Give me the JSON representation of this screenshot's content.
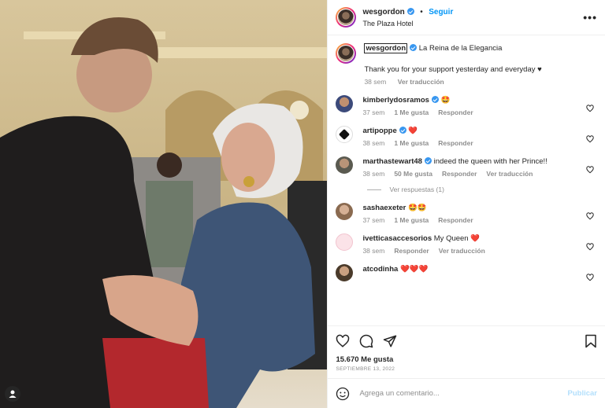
{
  "post": {
    "username": "wesgordon",
    "follow_label": "Seguir",
    "dot": "•",
    "location": "The Plaza Hotel",
    "more": "•••",
    "caption_user": "wesgordon",
    "caption_text": "La Reina de la Elegancia",
    "caption_body": "Thank you for your support yesterday and everyday ♥",
    "caption_time": "38 sem",
    "caption_translate": "Ver traducción",
    "likes": "15.670 Me gusta",
    "date": "SEPTIEMBRE 13, 2022"
  },
  "comments": [
    {
      "user": "kimberlydosramos",
      "text": "🤩",
      "time": "37 sem",
      "likes": "1 Me gusta",
      "reply": "Responder",
      "translate": ""
    },
    {
      "user": "artipoppe",
      "text": "❤️",
      "time": "38 sem",
      "likes": "1 Me gusta",
      "reply": "Responder",
      "translate": ""
    },
    {
      "user": "marthastewart48",
      "text": "indeed the queen with her Prince!!",
      "time": "38 sem",
      "likes": "50 Me gusta",
      "reply": "Responder",
      "translate": "Ver traducción"
    },
    {
      "user": "sashaexeter",
      "text": "🤩🤩",
      "time": "37 sem",
      "likes": "1 Me gusta",
      "reply": "Responder",
      "translate": ""
    },
    {
      "user": "ivetticasaccesorios",
      "text": "My Queen ❤️",
      "time": "38 sem",
      "likes": "",
      "reply": "Responder",
      "translate": "Ver traducción"
    },
    {
      "user": "atcodinha",
      "text": "❤️❤️❤️",
      "time": "",
      "likes": "",
      "reply": "",
      "translate": ""
    }
  ],
  "view_replies": "Ver respuestas (1)",
  "add_comment": {
    "placeholder": "Agrega un comentario...",
    "publish": "Publicar"
  },
  "icons": {
    "like": "heart-icon",
    "comment": "comment-icon",
    "share": "share-icon",
    "save": "bookmark-icon",
    "emoji": "emoji-icon",
    "tag": "user-tag-icon"
  },
  "colors": {
    "link": "#0095f6",
    "verified": "#3897f0",
    "muted": "#8e8e8e",
    "publish_disabled": "#b2dffc"
  }
}
